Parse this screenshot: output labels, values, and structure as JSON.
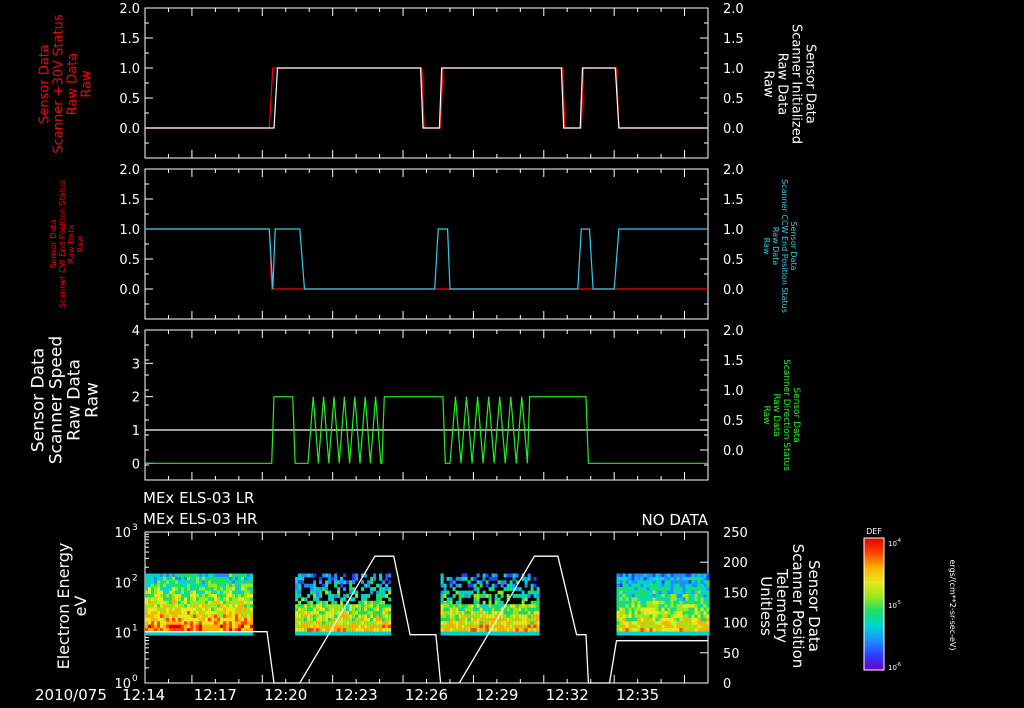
{
  "colors": {
    "background": "#000000",
    "axes": "#ffffff",
    "red": "#ff0000",
    "cyan": "#33ccee",
    "green": "#22ee22",
    "white": "#ffffff"
  },
  "time_axis": {
    "date_label": "2010/075",
    "tick_labels": [
      "12:14",
      "12:17",
      "12:20",
      "12:23",
      "12:26",
      "12:29",
      "12:32",
      "12:35"
    ],
    "range_minutes": [
      "12:14",
      "12:38"
    ]
  },
  "panels": [
    {
      "left_label": [
        "Sensor Data",
        "Scanner +30V Status",
        "Raw Data",
        "Raw"
      ],
      "right_label": [
        "Sensor Data",
        "Scanner Initialized",
        "Raw Data",
        "Raw"
      ],
      "left_ticks": [
        "2.0",
        "1.5",
        "1.0",
        "0.5",
        "0.0"
      ],
      "right_ticks": [
        "2.0",
        "1.5",
        "1.0",
        "0.5",
        "0.0"
      ]
    },
    {
      "left_label": [
        "Sensor Data",
        "Scanner CW End Position Status",
        "Raw Data",
        "Raw"
      ],
      "right_label": [
        "Sensor Data",
        "Scanner CCW End Position Status",
        "Raw Data",
        "Raw"
      ],
      "left_ticks": [
        "2.0",
        "1.5",
        "1.0",
        "0.5",
        "0.0"
      ],
      "right_ticks": [
        "2.0",
        "1.5",
        "1.0",
        "0.5",
        "0.0"
      ]
    },
    {
      "left_label": [
        "Sensor Data",
        "Scanner Speed",
        "Raw Data",
        "Raw"
      ],
      "right_label": [
        "Sensor Data",
        "Scanner Direction Status",
        "Raw Data",
        "Raw"
      ],
      "left_ticks": [
        "4",
        "3",
        "2",
        "1",
        "0"
      ],
      "right_ticks": [
        "2.0",
        "1.5",
        "1.0",
        "0.5",
        "0.0"
      ]
    },
    {
      "header_lines": [
        "MEx ELS-03 LR",
        "MEx ELS-03 HR"
      ],
      "no_data": "NO DATA",
      "left_label": [
        "Electron Energy",
        "eV"
      ],
      "right_label": [
        "Sensor Data",
        "Scanner Position",
        "Telemetry",
        "Unitless"
      ],
      "left_ticks": [
        "10",
        "10",
        "10",
        "10"
      ],
      "left_exponents": [
        "3",
        "2",
        "1",
        "0"
      ],
      "right_ticks": [
        "250",
        "200",
        "150",
        "100",
        "50",
        "0"
      ],
      "colorbar": {
        "title": "DEF",
        "tick_labels": [
          "10",
          "10",
          "10"
        ],
        "tick_exponents": [
          "-4",
          "-5",
          "-6"
        ],
        "unit": "ergs/(cm**2-sr-sec-eV)"
      }
    }
  ],
  "chart_data": [
    {
      "type": "line",
      "title": "",
      "xlim_minutes": [
        0,
        24
      ],
      "ylim": [
        -0.5,
        2.0
      ],
      "series": [
        {
          "color": "red",
          "points": [
            [
              0,
              0
            ],
            [
              5.3,
              0
            ],
            [
              5.45,
              1
            ],
            [
              11.8,
              1
            ],
            [
              11.9,
              0
            ],
            [
              12.6,
              0
            ],
            [
              12.7,
              1
            ],
            [
              17.8,
              1
            ],
            [
              17.9,
              0
            ],
            [
              18.6,
              0
            ],
            [
              18.7,
              1
            ],
            [
              20.1,
              1
            ],
            [
              20.2,
              0
            ],
            [
              24,
              0
            ]
          ]
        },
        {
          "color": "white",
          "points": [
            [
              0,
              0
            ],
            [
              5.5,
              0
            ],
            [
              5.65,
              1
            ],
            [
              11.75,
              1
            ],
            [
              11.85,
              0
            ],
            [
              12.55,
              0
            ],
            [
              12.65,
              1
            ],
            [
              17.75,
              1
            ],
            [
              17.85,
              0
            ],
            [
              18.55,
              0
            ],
            [
              18.65,
              1
            ],
            [
              20.05,
              1
            ],
            [
              20.2,
              0
            ],
            [
              24,
              0
            ]
          ]
        }
      ]
    },
    {
      "type": "line",
      "title": "",
      "xlim_minutes": [
        0,
        24
      ],
      "ylim": [
        -0.5,
        2.0
      ],
      "series": [
        {
          "color": "red",
          "points": [
            [
              0,
              1
            ],
            [
              5.3,
              1
            ],
            [
              5.4,
              0
            ],
            [
              6.8,
              0
            ],
            [
              6.8,
              0
            ],
            [
              24,
              0
            ]
          ]
        },
        {
          "color": "cyan",
          "points": [
            [
              0,
              1
            ],
            [
              5.3,
              1
            ],
            [
              5.45,
              0
            ],
            [
              5.55,
              1
            ],
            [
              6.6,
              1
            ],
            [
              6.8,
              0
            ],
            [
              12.35,
              0
            ],
            [
              12.5,
              1
            ],
            [
              12.9,
              1
            ],
            [
              13.0,
              0
            ],
            [
              18.45,
              0
            ],
            [
              18.6,
              1
            ],
            [
              18.95,
              1
            ],
            [
              19.1,
              0
            ],
            [
              20.0,
              0
            ],
            [
              20.2,
              1
            ],
            [
              24,
              1
            ]
          ]
        }
      ]
    },
    {
      "type": "line",
      "title": "",
      "xlim_minutes": [
        0,
        24
      ],
      "ylim": [
        -0.5,
        4.0
      ],
      "series": [
        {
          "color": "white",
          "points": [
            [
              0,
              1
            ],
            [
              24,
              1
            ]
          ]
        },
        {
          "color": "green",
          "zigzag": [
            [
              6.95,
              10.05
            ],
            [
              13.0,
              16.3
            ]
          ],
          "points": [
            [
              0,
              0
            ],
            [
              5.4,
              0
            ],
            [
              5.5,
              2
            ],
            [
              6.3,
              2
            ],
            [
              6.4,
              0
            ],
            [
              6.9,
              0
            ],
            [
              10.1,
              0
            ],
            [
              10.2,
              2
            ],
            [
              12.7,
              2
            ],
            [
              12.8,
              0
            ],
            [
              13.0,
              0
            ],
            [
              16.3,
              0
            ],
            [
              16.4,
              2
            ],
            [
              18.8,
              2
            ],
            [
              18.9,
              0
            ],
            [
              24,
              0
            ]
          ]
        }
      ]
    },
    {
      "type": "heatmap",
      "title": "",
      "xlim_minutes": [
        0,
        24
      ],
      "ylim_log": [
        0,
        3
      ],
      "spectrogram_blocks_minutes": [
        [
          0,
          4.5
        ],
        [
          6.4,
          10.4
        ],
        [
          12.6,
          16.7
        ],
        [
          20.1,
          24
        ]
      ],
      "energy_range_ev": [
        9,
        150
      ],
      "position_series": {
        "color": "white",
        "ylim": [
          0,
          250
        ],
        "points": [
          [
            0,
            85
          ],
          [
            5.2,
            85
          ],
          [
            5.5,
            0
          ],
          [
            6.6,
            0
          ],
          [
            9.8,
            210
          ],
          [
            10.6,
            210
          ],
          [
            11.3,
            80
          ],
          [
            12.4,
            80
          ],
          [
            12.6,
            0
          ],
          [
            13.4,
            0
          ],
          [
            16.6,
            210
          ],
          [
            17.6,
            210
          ],
          [
            18.4,
            80
          ],
          [
            18.8,
            80
          ],
          [
            18.9,
            0
          ],
          [
            19.8,
            0
          ],
          [
            20.1,
            70
          ],
          [
            24,
            70
          ]
        ]
      }
    }
  ]
}
